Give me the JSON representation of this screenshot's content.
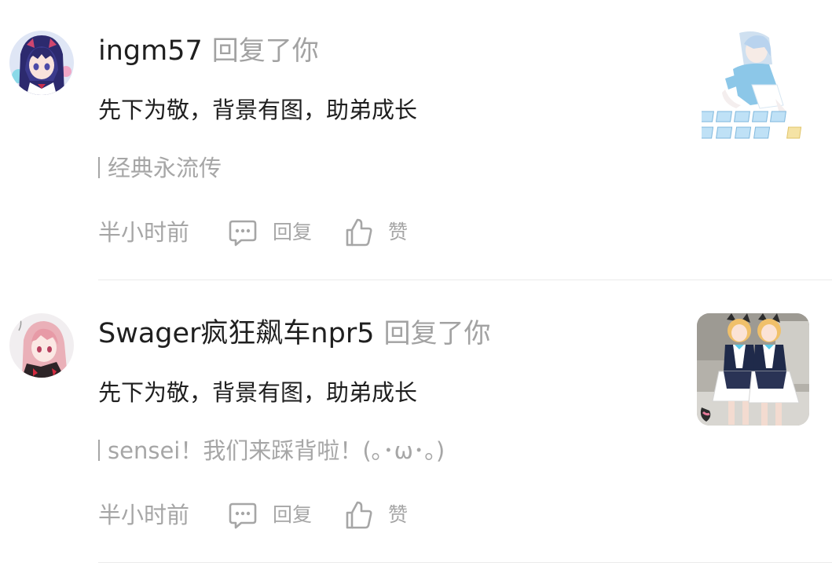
{
  "notifications": [
    {
      "username": "ingm57",
      "action": "回复了你",
      "reply_text": "先下为敬，背景有图，助弟成长",
      "quote": "经典永流传",
      "time": "半小时前",
      "reply_label": "回复",
      "like_label": "赞",
      "avatar_icon": "anime-girl-purple-hair-avatar",
      "thumbnail": "anime-girl-cards-thumbnail"
    },
    {
      "username": "Swager疯狂飙车npr5",
      "action": "回复了你",
      "reply_text": "先下为敬，背景有图，助弟成长",
      "quote": "sensei！我们来踩背啦！(｡･ω･｡)",
      "time": "半小时前",
      "reply_label": "回复",
      "like_label": "赞",
      "avatar_icon": "anime-girl-pink-hair-avatar",
      "thumbnail": "maid-twins-thumbnail"
    }
  ],
  "colors": {
    "primary_text": "#1f1f1f",
    "secondary_text": "#a6a6a6",
    "divider": "#ebebeb",
    "background": "#ffffff"
  }
}
